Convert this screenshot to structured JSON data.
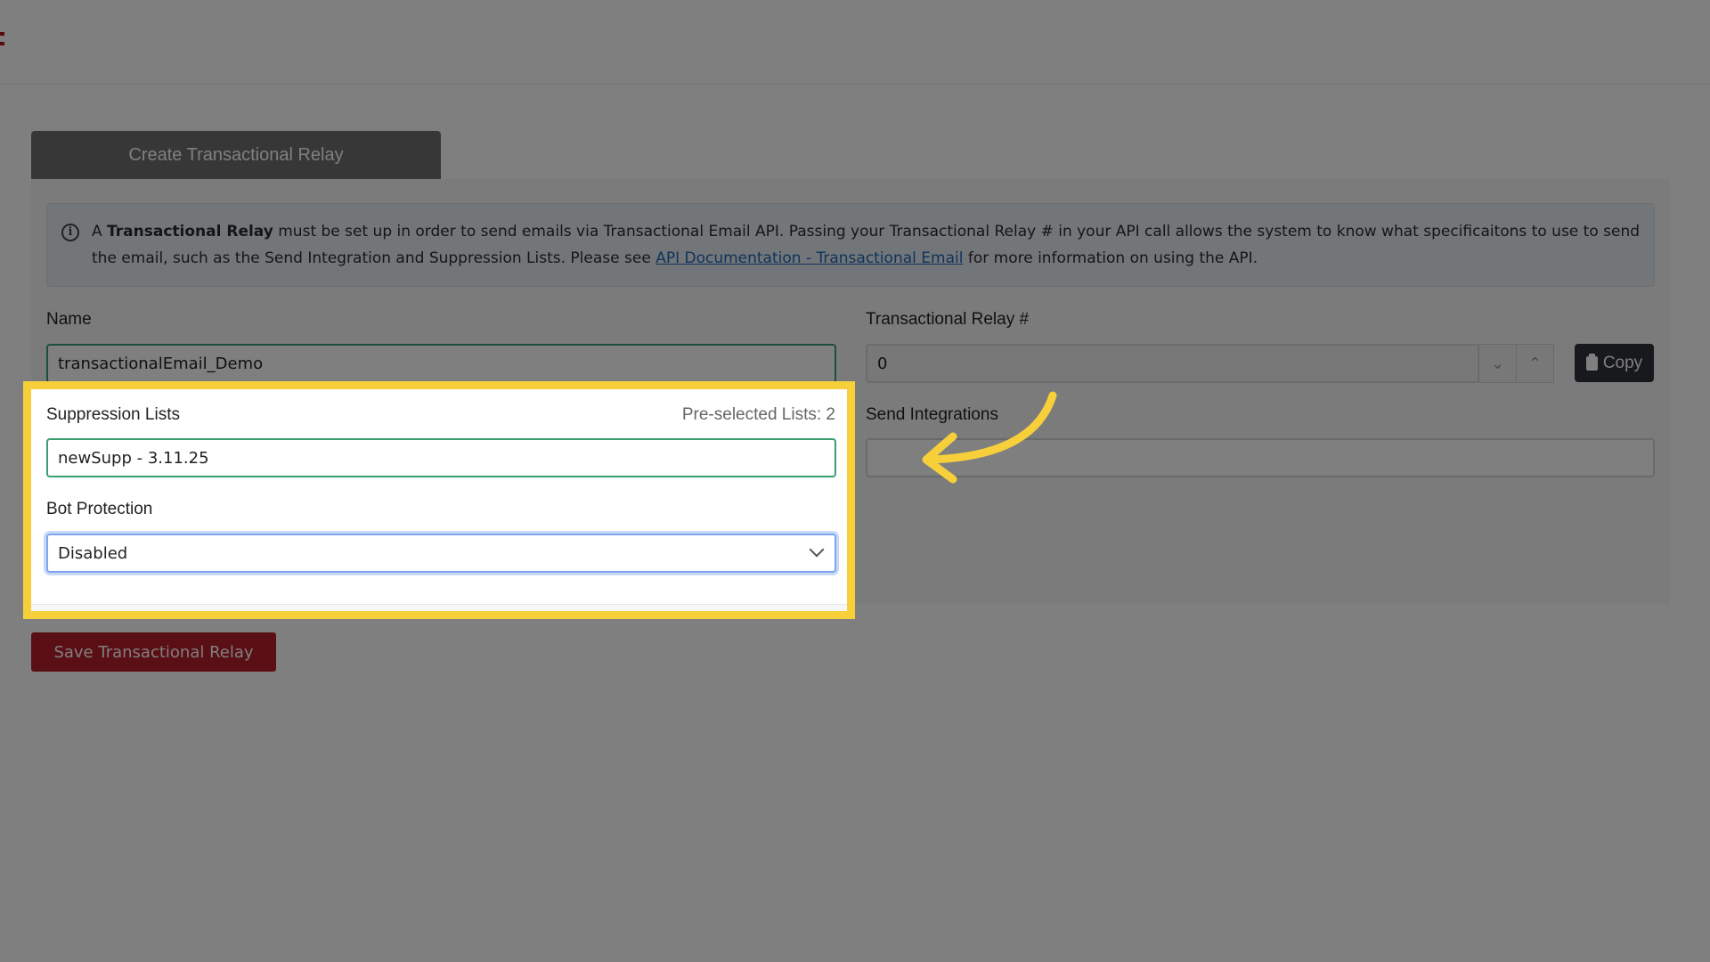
{
  "tab": {
    "label": "Create Transactional Relay"
  },
  "info": {
    "prefix": "A ",
    "bold": "Transactional Relay",
    "text_a": " must be set up in order to send emails via Transactional Email API. Passing your Transactional Relay # in your API call allows the system to know what specificaitons to use to send the email, such as the Send Integration and Suppression Lists. Please see ",
    "link": "API Documentation - Transactional Email",
    "text_b": " for more information on using the API."
  },
  "name": {
    "label": "Name",
    "value": "transactionalEmail_Demo"
  },
  "relay": {
    "label": "Transactional Relay #",
    "value": "0",
    "copy_label": "Copy"
  },
  "suppression": {
    "label": "Suppression Lists",
    "preselected": "Pre-selected Lists: 2",
    "value": "newSupp - 3.11.25"
  },
  "send_integrations": {
    "label": "Send Integrations",
    "value": ""
  },
  "bot_protection": {
    "label": "Bot Protection",
    "value": "Disabled"
  },
  "save": {
    "label": "Save Transactional Relay"
  },
  "colors": {
    "brand": "#b41e2a",
    "highlight": "#f7cf3b",
    "tab": "#6f6f6f"
  }
}
